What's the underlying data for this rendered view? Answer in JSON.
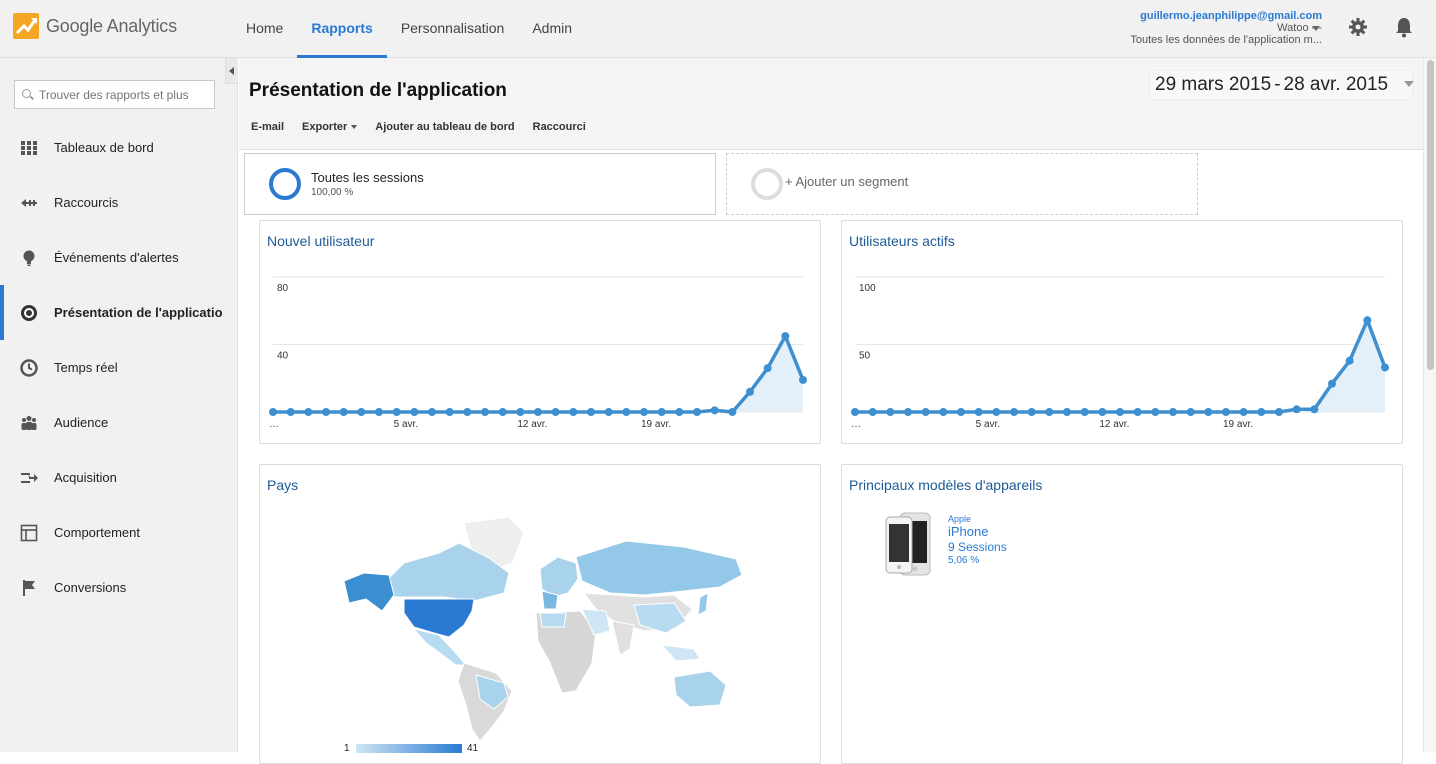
{
  "header": {
    "brand": "Google Analytics",
    "nav": [
      {
        "label": "Home",
        "active": false
      },
      {
        "label": "Rapports",
        "active": true
      },
      {
        "label": "Personnalisation",
        "active": false
      },
      {
        "label": "Admin",
        "active": false
      }
    ],
    "account": {
      "email": "guillermo.jeanphilippe@gmail.com",
      "property": "Watoo - -",
      "view": "Toutes les données de l'application m..."
    },
    "icons": [
      "gear-icon",
      "bell-icon"
    ],
    "accent_color": "#2a7ad4"
  },
  "sidebar": {
    "search_placeholder": "Trouver des rapports et plus",
    "items": [
      {
        "label": "Tableaux de bord",
        "icon": "grid-icon"
      },
      {
        "label": "Raccourcis",
        "icon": "shortcut-arrow-icon"
      },
      {
        "label": "Événements d'alertes",
        "icon": "lightbulb-icon"
      },
      {
        "label": "Présentation de l'applicatio",
        "icon": "app-overview-icon",
        "active": true
      },
      {
        "label": "Temps réel",
        "icon": "clock-icon"
      },
      {
        "label": "Audience",
        "icon": "people-icon"
      },
      {
        "label": "Acquisition",
        "icon": "acquisition-arrows-icon"
      },
      {
        "label": "Comportement",
        "icon": "layout-icon"
      },
      {
        "label": "Conversions",
        "icon": "flag-icon"
      }
    ]
  },
  "page": {
    "title": "Présentation de l'application",
    "date_start": "29 mars 2015",
    "date_sep": "-",
    "date_end": "28 avr. 2015",
    "toolbar": {
      "email": "E-mail",
      "export": "Exporter",
      "add_dashboard": "Ajouter au tableau de bord",
      "shortcut": "Raccourci"
    }
  },
  "segments": {
    "active_name": "Toutes les sessions",
    "active_pct": "100,00 %",
    "add_label": "+ Ajouter un segment"
  },
  "cards": {
    "new_users_title": "Nouvel utilisateur",
    "active_users_title": "Utilisateurs actifs",
    "country_title": "Pays",
    "devices_title": "Principaux modèles d'appareils"
  },
  "chart_data": [
    {
      "type": "area",
      "title": "Nouvel utilisateur",
      "x_tick_labels": [
        "…",
        "5 avr.",
        "12 avr.",
        "19 avr."
      ],
      "y_tick_labels": [
        "80",
        "40"
      ],
      "ylim": [
        0,
        80
      ],
      "grid": true,
      "values": [
        0,
        0,
        0,
        0,
        0,
        0,
        0,
        0,
        0,
        0,
        0,
        0,
        0,
        0,
        0,
        0,
        0,
        0,
        0,
        0,
        0,
        0,
        0,
        0,
        0,
        1,
        0,
        12,
        26,
        45,
        19
      ]
    },
    {
      "type": "area",
      "title": "Utilisateurs actifs",
      "x_tick_labels": [
        "…",
        "5 avr.",
        "12 avr.",
        "19 avr."
      ],
      "y_tick_labels": [
        "100",
        "50"
      ],
      "ylim": [
        0,
        100
      ],
      "grid": true,
      "values": [
        0,
        0,
        0,
        0,
        0,
        0,
        0,
        0,
        0,
        0,
        0,
        0,
        0,
        0,
        0,
        0,
        0,
        0,
        0,
        0,
        0,
        0,
        0,
        0,
        0,
        2,
        2,
        21,
        38,
        68,
        33
      ]
    }
  ],
  "map": {
    "legend_min": "1",
    "legend_max": "41",
    "color_low": "#cfe6f5",
    "color_high": "#2a7ad4"
  },
  "device": {
    "brand": "Apple",
    "model": "iPhone",
    "sessions": "9 Sessions",
    "pct": "5,06 %"
  }
}
